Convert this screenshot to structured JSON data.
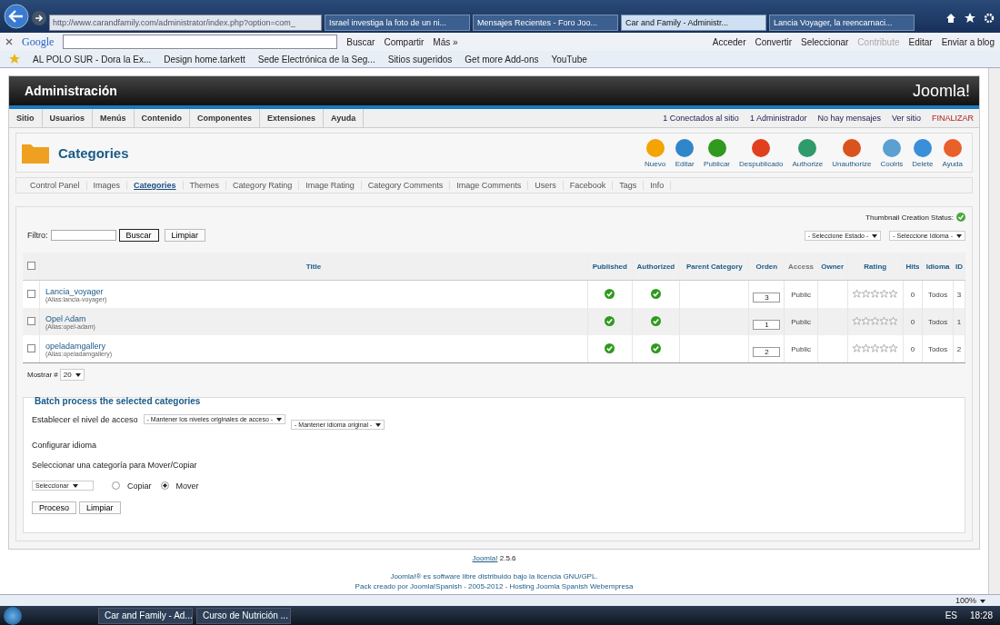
{
  "browser": {
    "address": "http://www.carandfamily.com/administrator/index.php?option=com_",
    "tabs": [
      {
        "label": "Israel investiga la foto de un ni...",
        "selected": false
      },
      {
        "label": "Mensajes Recientes - Foro Joo...",
        "selected": false
      },
      {
        "label": "Car and Family - Administr...",
        "selected": true
      },
      {
        "label": "Lancia Voyager, la reencarnaci...",
        "selected": false
      }
    ],
    "toolbar": {
      "logo": "Google",
      "items": [
        "Buscar",
        "Compartir",
        "Más »"
      ],
      "right": [
        "Acceder",
        "Convertir",
        "Seleccionar",
        "Contribute",
        "Editar",
        "Enviar a blog"
      ]
    },
    "favorites": [
      "AL POLO SUR - Dora la Ex...",
      "Design  home.tarkett",
      "Sede Electrónica de la Seg...",
      "Sitios sugeridos",
      "Get more Add-ons",
      "YouTube"
    ],
    "zoom": "100%"
  },
  "header": {
    "title": "Administración",
    "logo": "Joomla!"
  },
  "menu": [
    "Sitio",
    "Usuarios",
    "Menús",
    "Contenido",
    "Componentes",
    "Extensiones",
    "Ayuda"
  ],
  "status_links": [
    "1 Conectados al sitio",
    "1 Administrador",
    "No hay mensajes",
    "Ver sitio",
    "FINALIZAR"
  ],
  "page_title": "Categories",
  "toolbar_buttons": [
    {
      "label": "Nuevo",
      "color": "#f4a300"
    },
    {
      "label": "Editar",
      "color": "#2f86c8"
    },
    {
      "label": "Publicar",
      "color": "#2f9a1e"
    },
    {
      "label": "Despublicado",
      "color": "#e0401e"
    },
    {
      "label": "Authorize",
      "color": "#2f9a6a"
    },
    {
      "label": "Unauthorize",
      "color": "#d9531e"
    },
    {
      "label": "Coolris",
      "color": "#5aa0d0"
    },
    {
      "label": "Delete",
      "color": "#3a8fd8"
    },
    {
      "label": "Ayuda",
      "color": "#e8602a"
    }
  ],
  "subtabs": [
    {
      "label": "Control Panel",
      "selected": false
    },
    {
      "label": "Images",
      "selected": false
    },
    {
      "label": "Categories",
      "selected": true
    },
    {
      "label": "Themes",
      "selected": false
    },
    {
      "label": "Category Rating",
      "selected": false
    },
    {
      "label": "Image Rating",
      "selected": false
    },
    {
      "label": "Category Comments",
      "selected": false
    },
    {
      "label": "Image Comments",
      "selected": false
    },
    {
      "label": "Users",
      "selected": false
    },
    {
      "label": "Facebook",
      "selected": false
    },
    {
      "label": "Tags",
      "selected": false
    },
    {
      "label": "Info",
      "selected": false
    }
  ],
  "thumbnail_status": "Thumbnail Creation Status:",
  "filter": {
    "label": "Filtro:",
    "buttons": [
      "Buscar",
      "Limpiar"
    ],
    "selects": [
      "- Seleccione Estado -",
      "- Seleccione Idioma -"
    ]
  },
  "table": {
    "columns": [
      "Title",
      "Published",
      "Authorized",
      "Parent Category",
      "Orden",
      "Access",
      "Owner",
      "Rating",
      "Hits",
      "Idioma",
      "ID"
    ],
    "select_all_checked": false,
    "rows": [
      {
        "checked": false,
        "title": "Lancia_voyager",
        "alias": "(Alias:lancia-voyager)",
        "published": true,
        "authorized": true,
        "order": "3",
        "access": "Public",
        "stars": 0,
        "hits": "0",
        "language": "Todos",
        "id": "3"
      },
      {
        "checked": false,
        "title": "Opel Adam",
        "alias": "(Alias:opel-adam)",
        "published": true,
        "authorized": true,
        "order": "1",
        "access": "Public",
        "stars": 0,
        "hits": "0",
        "language": "Todos",
        "id": "1"
      },
      {
        "checked": false,
        "title": "opeladamgallery",
        "alias": "(Alias:opeladamgallery)",
        "published": true,
        "authorized": true,
        "order": "2",
        "access": "Public",
        "stars": 0,
        "hits": "0",
        "language": "Todos",
        "id": "2"
      }
    ]
  },
  "pagination": {
    "label": "Mostrar #",
    "value": "20"
  },
  "batch": {
    "legend": "Batch process the selected categories",
    "access_label": "Establecer el nivel de acceso",
    "access_select": "- Mantener los niveles originales de acceso -",
    "language_select": "- Mantener idioma original -",
    "language_label": "Configurar idioma",
    "category_label": "Seleccionar una categoría para Mover/Copiar",
    "category_select": "Seleccionar",
    "options": [
      {
        "label": "Copiar",
        "selected": false
      },
      {
        "label": "Mover",
        "selected": true
      }
    ],
    "buttons": [
      "Proceso",
      "Limpiar"
    ]
  },
  "footer": {
    "link": "Joomla!",
    "version": "2.5.6",
    "license": "Joomla!® es software libre distribuido bajo la licencia GNU/GPL.",
    "credits": "Pack creado por Joomla!Spanish - 2005-2012 - Hosting Joomla Spanish Webempresa"
  },
  "taskbar": {
    "items": [
      "Car and Family - Ad...",
      "Curso de Nutrición ..."
    ],
    "language": "ES",
    "time": "18:28"
  }
}
